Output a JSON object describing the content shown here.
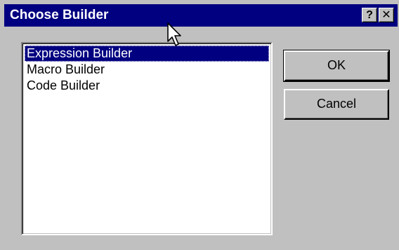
{
  "window": {
    "title": "Choose Builder",
    "help_label": "?",
    "close_label": "✕"
  },
  "builder_list": {
    "items": [
      {
        "label": "Expression Builder",
        "selected": true
      },
      {
        "label": "Macro Builder",
        "selected": false
      },
      {
        "label": "Code Builder",
        "selected": false
      }
    ]
  },
  "buttons": {
    "ok_label": "OK",
    "cancel_label": "Cancel"
  },
  "colors": {
    "titlebar": "#000080",
    "face": "#c0c0c0",
    "selection": "#000080"
  },
  "icons": {
    "cursor": "mouse-pointer-icon"
  }
}
